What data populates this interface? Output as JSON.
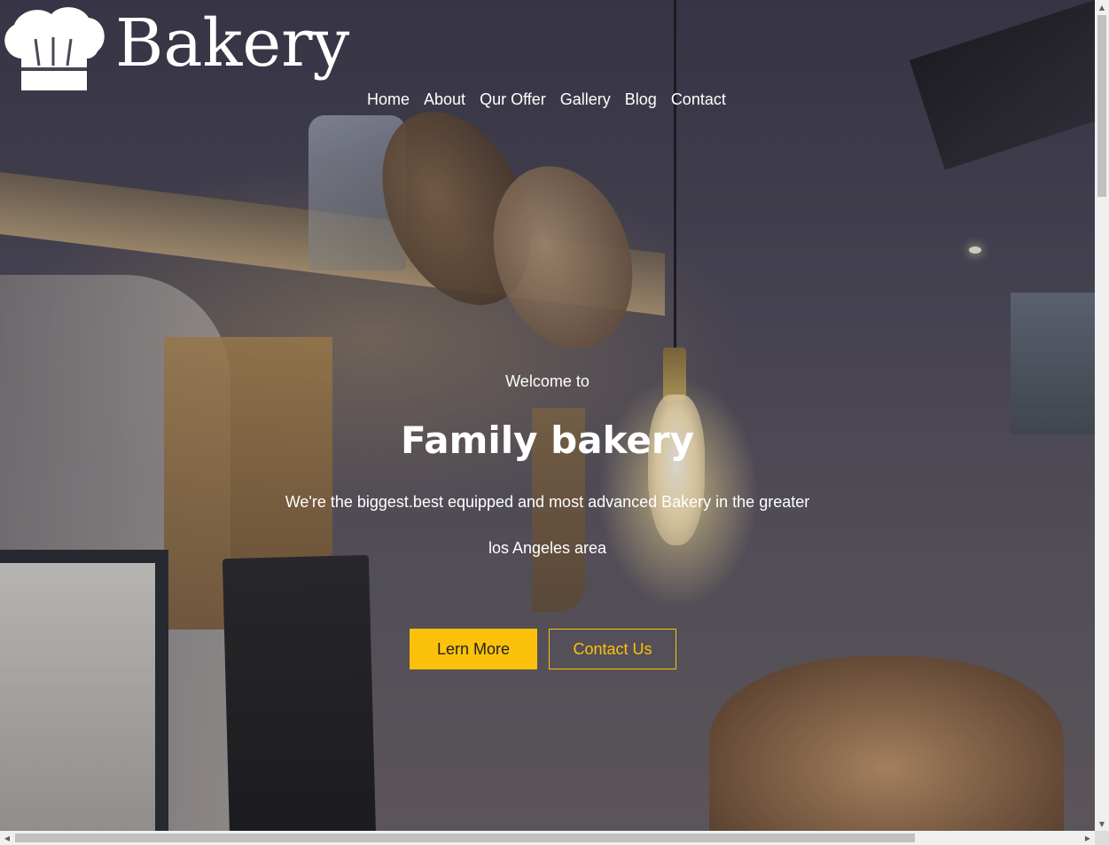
{
  "brand": {
    "name": "Bakery",
    "logo_icon": "chef-hat-icon"
  },
  "nav": {
    "items": [
      {
        "label": "Home"
      },
      {
        "label": "About"
      },
      {
        "label": "Qur Offer"
      },
      {
        "label": "Gallery"
      },
      {
        "label": "Blog"
      },
      {
        "label": "Contact"
      }
    ]
  },
  "hero": {
    "welcome": "Welcome to",
    "title": "Family bakery",
    "description_line1": "We're the biggest.best equipped and most advanced Bakery in the greater",
    "description_line2": "los Angeles area",
    "primary_button": "Lern More",
    "secondary_button": "Contact Us"
  },
  "colors": {
    "accent": "#fcc10a",
    "text": "#ffffff"
  }
}
